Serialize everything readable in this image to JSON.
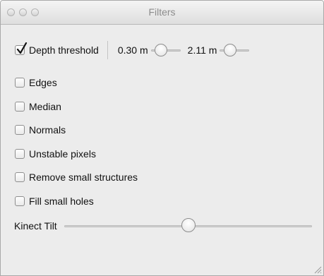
{
  "window": {
    "title": "Filters",
    "controls": [
      "close-button",
      "minimize-button",
      "zoom-button"
    ]
  },
  "depth_threshold": {
    "label": "Depth threshold",
    "checked": true,
    "min_value": "0.30 m",
    "max_value": "2.11 m",
    "min_slider_fraction": 0.2,
    "max_slider_fraction": 0.25
  },
  "filters": [
    {
      "label": "Edges",
      "checked": false
    },
    {
      "label": "Median",
      "checked": false
    },
    {
      "label": "Normals",
      "checked": false
    },
    {
      "label": "Unstable pixels",
      "checked": false
    },
    {
      "label": "Remove small structures",
      "checked": false
    },
    {
      "label": "Fill small holes",
      "checked": false
    }
  ],
  "kinect_tilt": {
    "label": "Kinect Tilt",
    "slider_fraction": 0.5
  },
  "icons": {
    "checkmark": "checkmark-icon",
    "resize": "resize-grip-icon"
  },
  "colors": {
    "window_bg": "#ececec",
    "titlebar_text": "#8c8c8c"
  }
}
